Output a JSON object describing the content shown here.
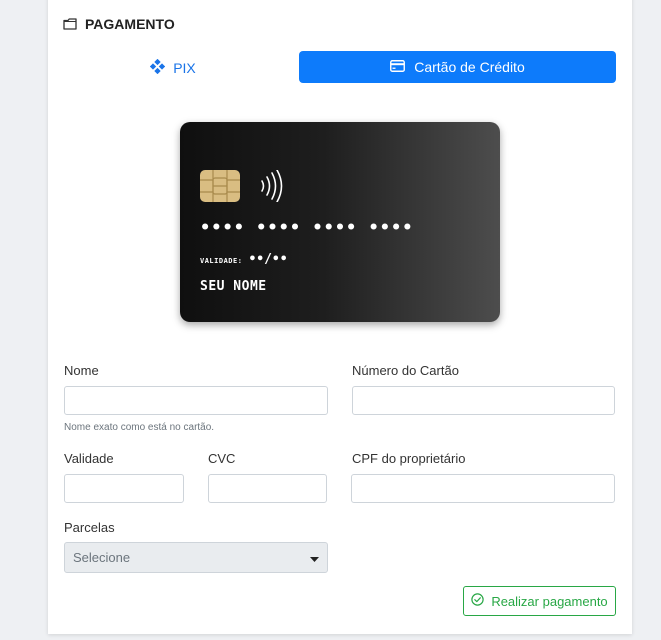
{
  "section": {
    "title": "PAGAMENTO",
    "icon": "folder-icon"
  },
  "tabs": {
    "pix": {
      "label": "PIX",
      "icon": "pix-diamond-icon",
      "color": "#1a74e8"
    },
    "credit_card": {
      "label": "Cartão de Crédito",
      "icon": "credit-card-icon",
      "active": true,
      "color": "#0d7bfb"
    }
  },
  "card_preview": {
    "number": "•••• •••• •••• ••••",
    "validity_label": "VALIDADE:",
    "validity_value": "••/••",
    "holder": "SEU NOME"
  },
  "form": {
    "name": {
      "label": "Nome",
      "value": "",
      "hint": "Nome exato como está no cartão."
    },
    "card_number": {
      "label": "Número do Cartão",
      "value": ""
    },
    "expiry": {
      "label": "Validade",
      "value": ""
    },
    "cvc": {
      "label": "CVC",
      "value": ""
    },
    "owner_cpf": {
      "label": "CPF do proprietário",
      "value": ""
    },
    "installments": {
      "label": "Parcelas",
      "selected": "Selecione"
    }
  },
  "submit": {
    "label": "Realizar pagamento",
    "icon": "check-circle-icon",
    "color": "#28a745"
  }
}
